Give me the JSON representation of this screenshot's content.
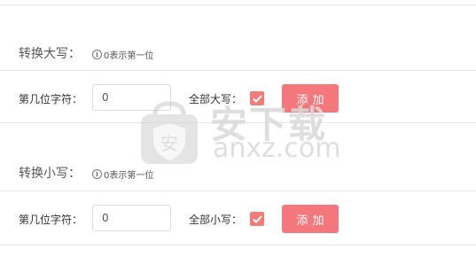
{
  "upper": {
    "title": "转换大写：",
    "hint_icon": "i",
    "hint": "0表示第一位",
    "position_label": "第几位字符：",
    "position_value": "0",
    "all_label": "全部大写：",
    "all_checked": true,
    "add_button": "添加"
  },
  "lower": {
    "title": "转换小写：",
    "hint_icon": "i",
    "hint": "0表示第一位",
    "position_label": "第几位字符：",
    "position_value": "0",
    "all_label": "全部小写：",
    "all_checked": true,
    "add_button": "添加"
  },
  "watermark": {
    "cn": "安下载",
    "en": "anxz.com",
    "badge": "安"
  },
  "colors": {
    "accent": "#f4777b",
    "checkbox": "#f07c7c"
  }
}
